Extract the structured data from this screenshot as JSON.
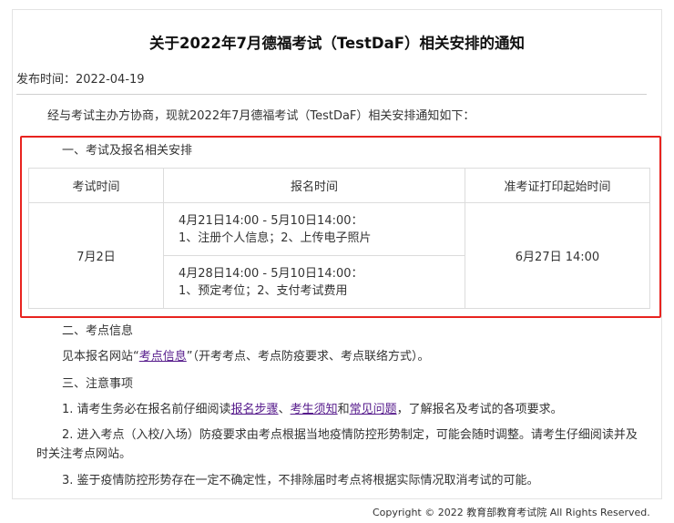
{
  "notice": {
    "title": "关于2022年7月德福考试（TestDaF）相关安排的通知",
    "pubdate": "发布时间：2022-04-19",
    "intro": "经与考试主办方协商，现就2022年7月德福考试（TestDaF）相关安排通知如下：",
    "section1": {
      "heading": "一、考试及报名相关安排",
      "table": {
        "headers": [
          "考试时间",
          "报名时间",
          "准考证打印起始时间"
        ],
        "exam_date": "7月2日",
        "periods": [
          {
            "time": "4月21日14:00 - 5月10日14:00：",
            "tasks": "1、注册个人信息；2、上传电子照片"
          },
          {
            "time": "4月28日14:00 - 5月10日14:00：",
            "tasks": "1、预定考位；2、支付考试费用"
          }
        ],
        "admission_print": "6月27日 14:00"
      }
    },
    "section2": {
      "heading": "二、考点信息",
      "text_before": "见本报名网站“",
      "link": "考点信息",
      "text_after": "”（开考考点、考点防疫要求、考点联络方式）。"
    },
    "section3": {
      "heading": "三、注意事项",
      "item1": {
        "prefix": "1. 请考生务必在报名前仔细阅读",
        "link1": "报名步骤",
        "sep1": "、",
        "link2": "考生须知",
        "sep2": "和",
        "link3": "常见问题",
        "suffix": "，了解报名及考试的各项要求。"
      },
      "item2": "2. 进入考点（入校/入场）防疫要求由考点根据当地疫情防控形势制定，可能会随时调整。请考生仔细阅读并及时关注考点网站。",
      "item3": "3. 鉴于疫情防控形势存在一定不确定性，不排除届时考点将根据实际情况取消考试的可能。"
    }
  },
  "footer": "Copyright © 2022 教育部教育考试院 All Rights Reserved.",
  "colors": {
    "highlight_border": "#e8231f",
    "link": "#551a8b"
  }
}
